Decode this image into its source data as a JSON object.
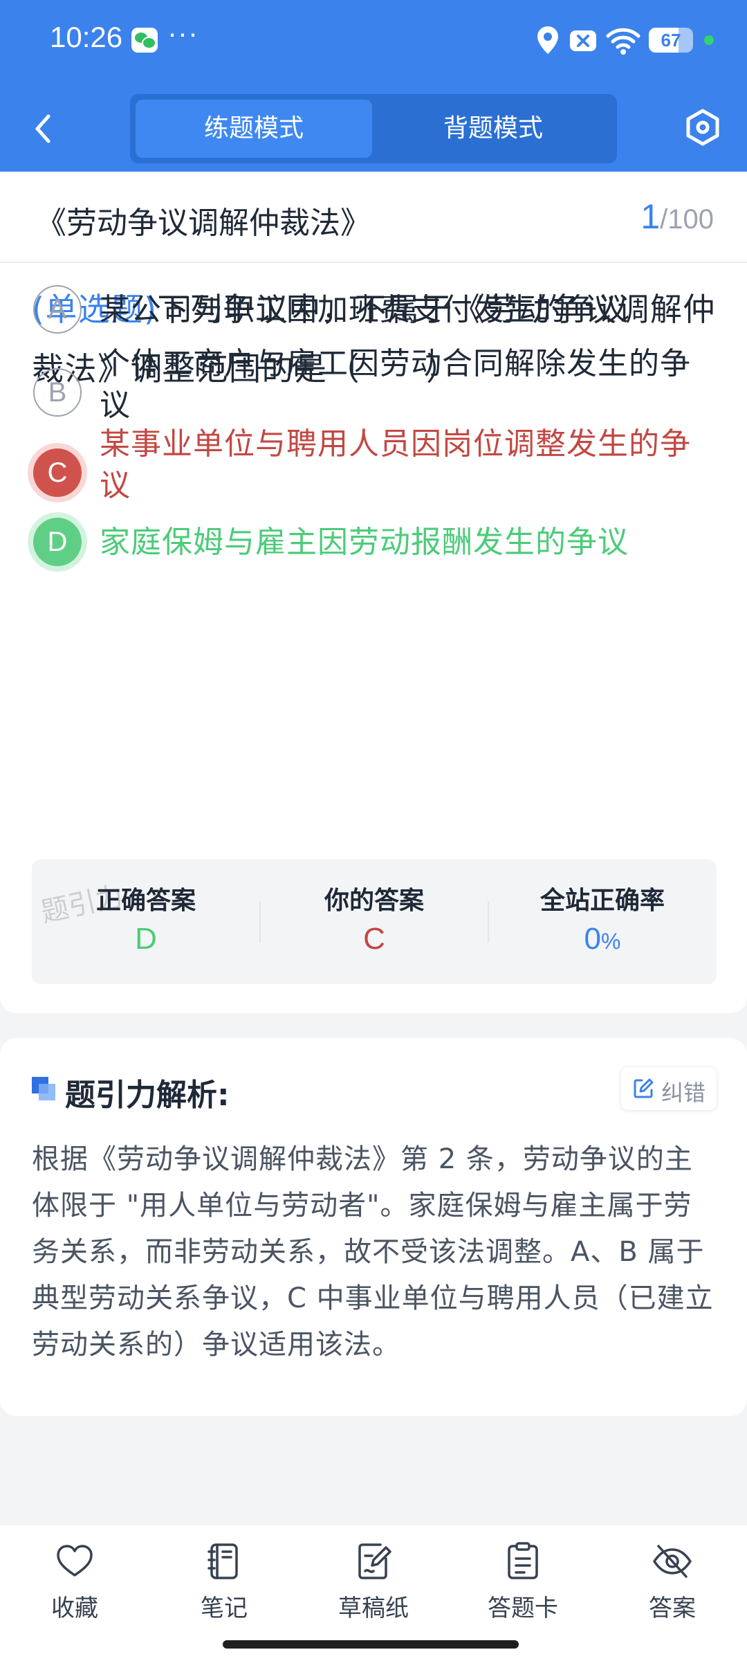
{
  "status_bar": {
    "time": "10:26",
    "more": "···",
    "battery_level": "67",
    "battery_fraction": 0.67,
    "icons": [
      "wechat-icon",
      "location-icon",
      "x-icon",
      "wifi-icon",
      "battery-icon"
    ]
  },
  "nav": {
    "back_icon": "chevron-left-icon",
    "tabs": [
      {
        "label": "练题模式",
        "active": true
      },
      {
        "label": "背题模式",
        "active": false
      }
    ],
    "settings_icon": "hexagon-settings-icon"
  },
  "question": {
    "book_title": "《劳动争议调解仲裁法》",
    "current": "1",
    "separator": "/",
    "total": "100",
    "type_label": "(单选题)",
    "text": "下列争议中，不属于《劳动争议调解仲裁法》调整范围的是（　　）",
    "options": [
      {
        "letter": "A",
        "text": "某公司与职工因加班费支付发生的争议",
        "state": "normal"
      },
      {
        "letter": "B",
        "text": "个体工商户与雇工因劳动合同解除发生的争议",
        "state": "normal"
      },
      {
        "letter": "C",
        "text": "某事业单位与聘用人员因岗位调整发生的争议",
        "state": "wrong"
      },
      {
        "letter": "D",
        "text": "家庭保姆与雇主因劳动报酬发生的争议",
        "state": "right"
      }
    ]
  },
  "answer_summary": {
    "watermark": "题引力",
    "correct_label": "正确答案",
    "correct_value": "D",
    "yours_label": "你的答案",
    "yours_value": "C",
    "rate_label": "全站正确率",
    "rate_value": "0",
    "rate_unit": "%"
  },
  "analysis": {
    "title": "题引力解析:",
    "fix_label": "纠错",
    "text": "根据《劳动争议调解仲裁法》第 2 条，劳动争议的主体限于 \"用人单位与劳动者\"。家庭保姆与雇主属于劳务关系，而非劳动关系，故不受该法调整。A、B 属于典型劳动关系争议，C 中事业单位与聘用人员（已建立劳动关系的）争议适用该法。"
  },
  "bottom_bar": {
    "tabs": [
      {
        "label": "收藏",
        "icon": "heart-icon"
      },
      {
        "label": "笔记",
        "icon": "notebook-icon"
      },
      {
        "label": "草稿纸",
        "icon": "draft-paper-icon"
      },
      {
        "label": "答题卡",
        "icon": "answer-sheet-icon"
      },
      {
        "label": "答案",
        "icon": "eye-off-icon"
      }
    ]
  },
  "colors": {
    "primary": "#3b82ed",
    "correct": "#4ccb79",
    "wrong": "#c24843"
  }
}
